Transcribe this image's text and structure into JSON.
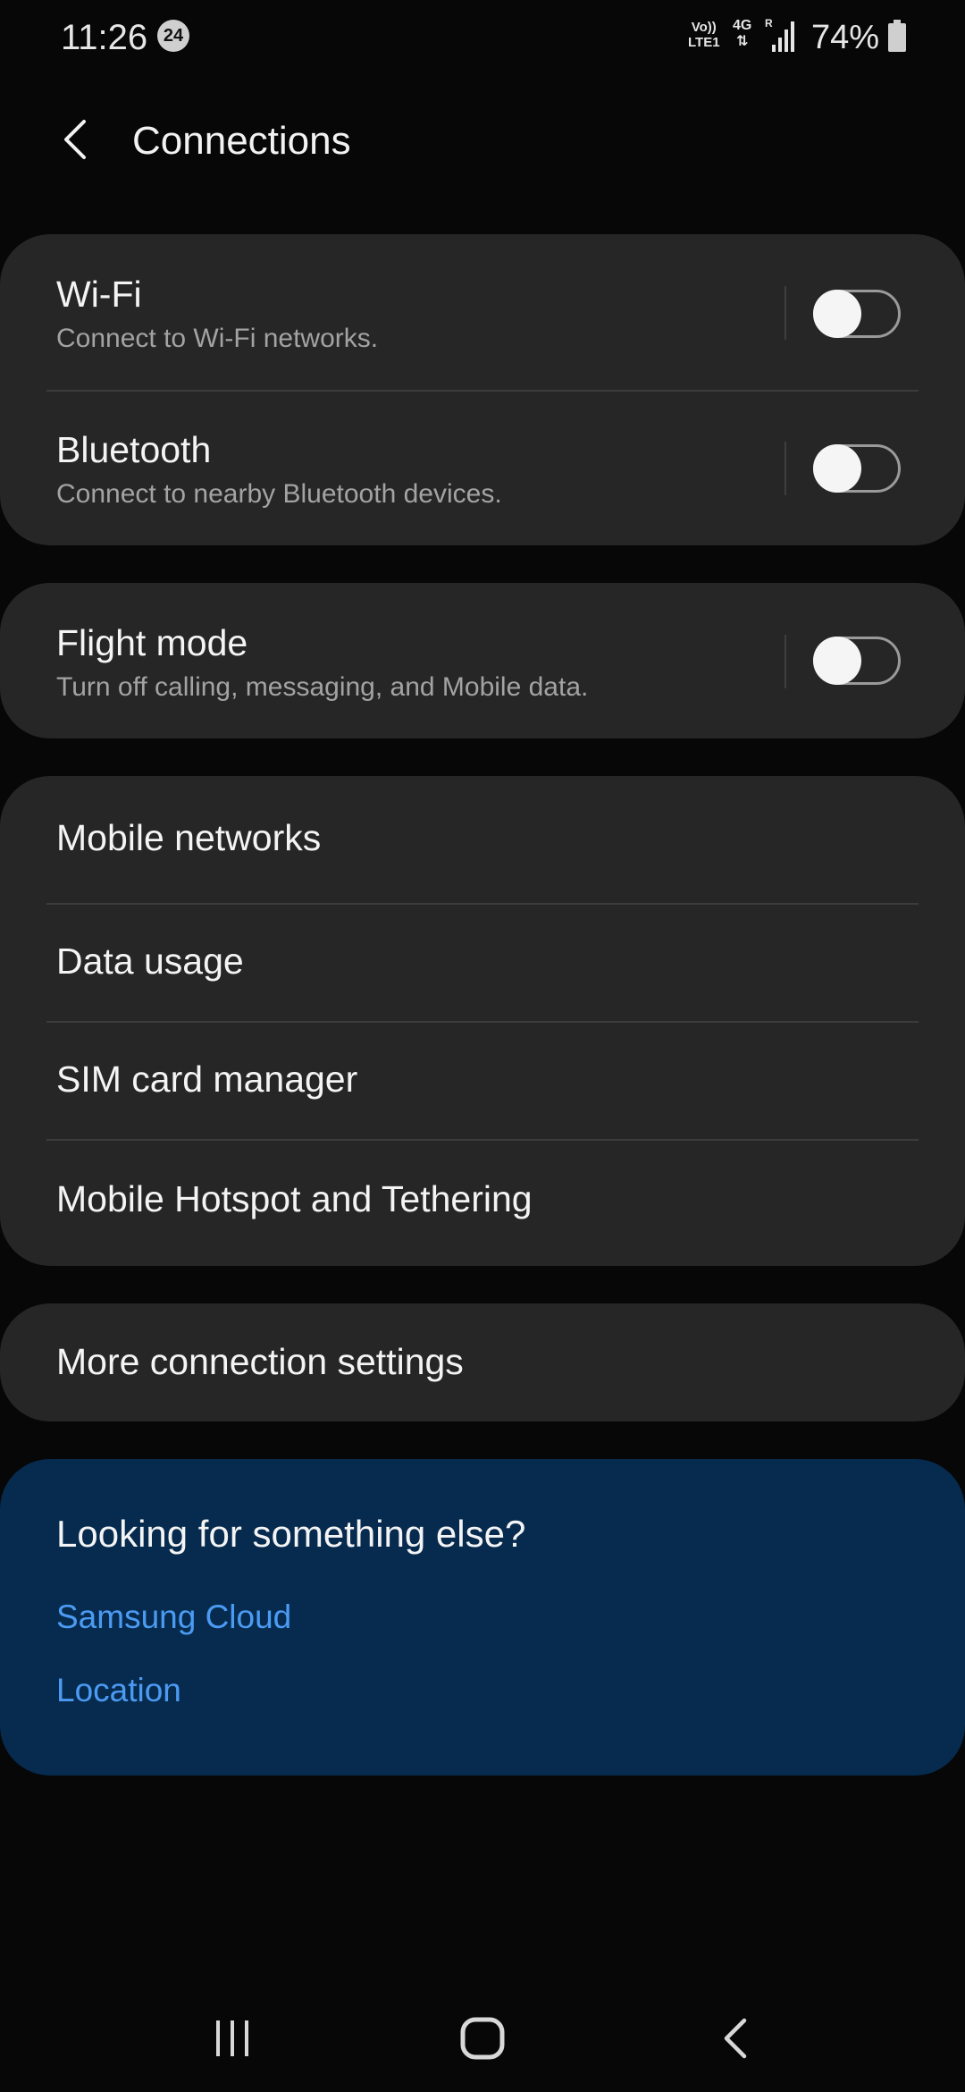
{
  "status_bar": {
    "time": "11:26",
    "notification_count": "24",
    "volte_top": "Vo))",
    "volte_bottom": "LTE1",
    "network_type": "4G",
    "roaming": "R",
    "battery_percent": "74%"
  },
  "header": {
    "title": "Connections"
  },
  "sections": {
    "wireless": [
      {
        "title": "Wi-Fi",
        "subtitle": "Connect to Wi-Fi networks.",
        "toggle_on": false
      },
      {
        "title": "Bluetooth",
        "subtitle": "Connect to nearby Bluetooth devices.",
        "toggle_on": false
      }
    ],
    "flight": {
      "title": "Flight mode",
      "subtitle": "Turn off calling, messaging, and Mobile data.",
      "toggle_on": false
    },
    "mobile": [
      {
        "title": "Mobile networks"
      },
      {
        "title": "Data usage"
      },
      {
        "title": "SIM card manager"
      },
      {
        "title": "Mobile Hotspot and Tethering"
      }
    ],
    "more": {
      "title": "More connection settings"
    }
  },
  "suggestions": {
    "title": "Looking for something else?",
    "links": [
      "Samsung Cloud",
      "Location"
    ]
  },
  "colors": {
    "background": "#070707",
    "card": "#262626",
    "suggestion_card": "#062b4f",
    "link": "#4c9bf3"
  },
  "icons": {
    "back": "chevron-left-icon",
    "signal": "signal-strength-icon",
    "battery": "battery-icon",
    "nav_recents": "recents-icon",
    "nav_home": "home-icon",
    "nav_back": "back-icon"
  }
}
